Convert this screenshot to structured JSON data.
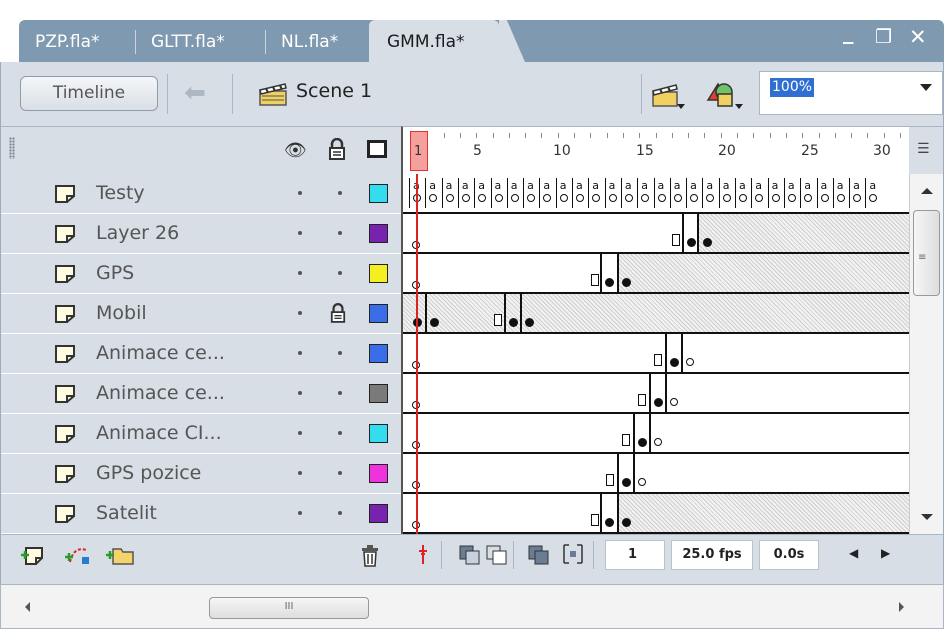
{
  "tabs": [
    {
      "label": "PZP.fla*",
      "active": false
    },
    {
      "label": "GLTT.fla*",
      "active": false
    },
    {
      "label": "NL.fla*",
      "active": false
    },
    {
      "label": "GMM.fla*",
      "active": true
    }
  ],
  "window": {
    "minimize": "_",
    "restore": "❐",
    "close": "✕"
  },
  "toolbar": {
    "timeline_label": "Timeline",
    "scene_label": "Scene 1",
    "zoom_value": "100%"
  },
  "header": {
    "eye_icon": "eye-icon",
    "lock_icon": "lock-icon",
    "outline_icon": "outline-icon"
  },
  "ruler": {
    "current_frame": "1",
    "labels": [
      "5",
      "10",
      "15",
      "20",
      "25",
      "30"
    ]
  },
  "layers": [
    {
      "name": "Testy",
      "color": "#33ddee",
      "locked": false
    },
    {
      "name": "Layer 26",
      "color": "#7a22b0",
      "locked": false
    },
    {
      "name": "GPS",
      "color": "#f5ee22",
      "locked": false
    },
    {
      "name": "Mobil",
      "color": "#3a6ee8",
      "locked": true
    },
    {
      "name": "Animace ce...",
      "color": "#3a6ee8",
      "locked": false
    },
    {
      "name": "Animace ce...",
      "color": "#7a7a7a",
      "locked": false
    },
    {
      "name": "Animace CI...",
      "color": "#33ddee",
      "locked": false
    },
    {
      "name": "GPS pozice",
      "color": "#ee33dd",
      "locked": false
    },
    {
      "name": "Satelit",
      "color": "#7a22b0",
      "locked": false
    }
  ],
  "footer": {
    "current_frame": "1",
    "fps": "25.0 fps",
    "time": "0.0s"
  },
  "hscroll": {
    "grip": "III"
  }
}
